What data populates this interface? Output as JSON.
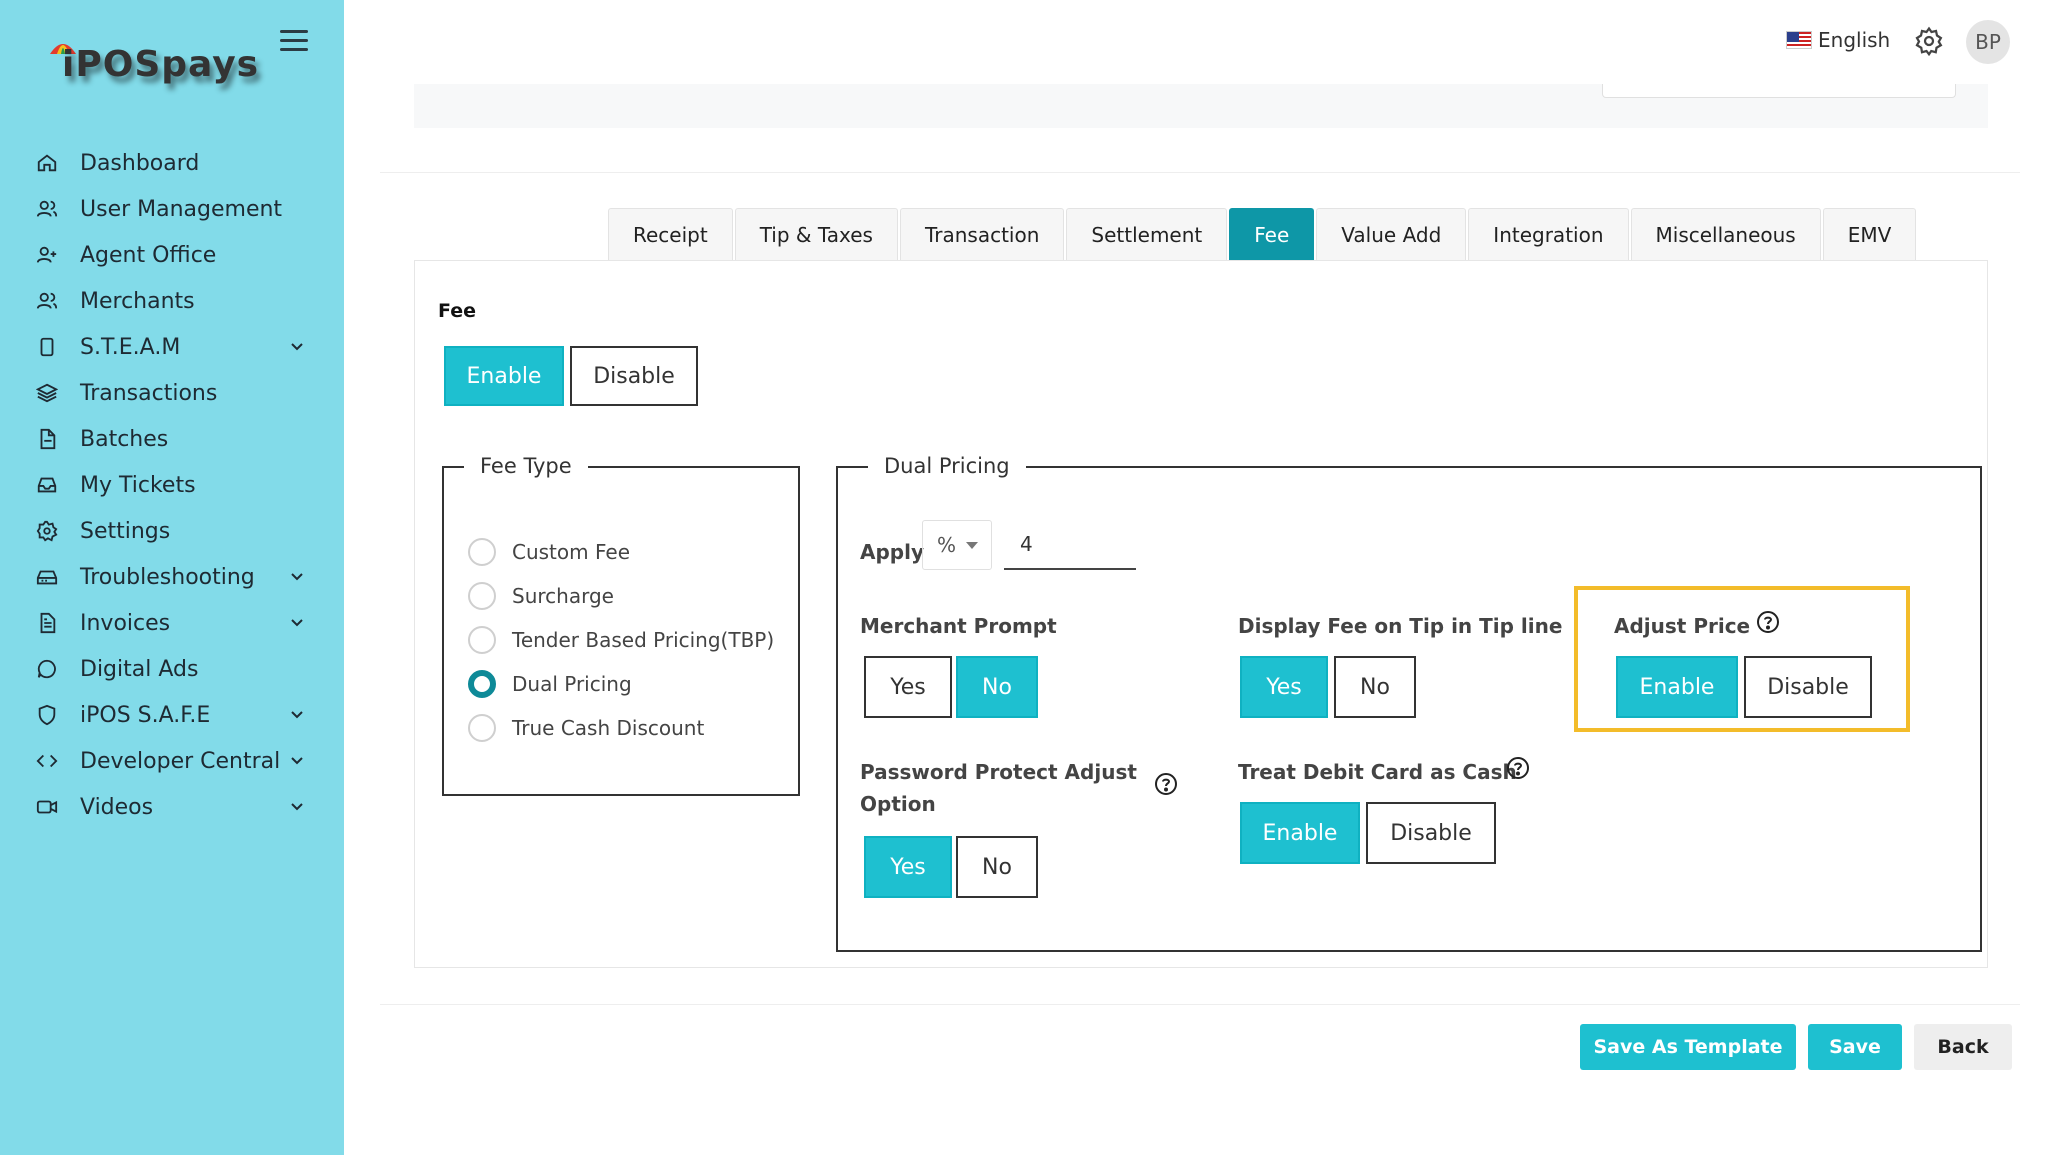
{
  "brand": {
    "logo_text": "iPOSpays"
  },
  "sidebar": {
    "items": [
      {
        "label": "Dashboard",
        "icon": "home-icon",
        "has_submenu": false
      },
      {
        "label": "User Management",
        "icon": "users-icon",
        "has_submenu": false
      },
      {
        "label": "Agent Office",
        "icon": "user-plus-icon",
        "has_submenu": false
      },
      {
        "label": "Merchants",
        "icon": "users-icon",
        "has_submenu": false
      },
      {
        "label": "S.T.E.A.M",
        "icon": "device-icon",
        "has_submenu": true
      },
      {
        "label": "Transactions",
        "icon": "layers-icon",
        "has_submenu": false
      },
      {
        "label": "Batches",
        "icon": "file-icon",
        "has_submenu": false
      },
      {
        "label": "My Tickets",
        "icon": "inbox-icon",
        "has_submenu": false
      },
      {
        "label": "Settings",
        "icon": "gear-icon",
        "has_submenu": false
      },
      {
        "label": "Troubleshooting",
        "icon": "drive-icon",
        "has_submenu": true
      },
      {
        "label": "Invoices",
        "icon": "invoice-icon",
        "has_submenu": true
      },
      {
        "label": "Digital Ads",
        "icon": "chat-icon",
        "has_submenu": false
      },
      {
        "label": "iPOS S.A.F.E",
        "icon": "shield-icon",
        "has_submenu": true
      },
      {
        "label": "Developer Central",
        "icon": "code-icon",
        "has_submenu": true
      },
      {
        "label": "Videos",
        "icon": "video-icon",
        "has_submenu": true
      }
    ]
  },
  "header": {
    "language": "English",
    "avatar_initials": "BP"
  },
  "tabs": [
    {
      "label": "Receipt",
      "active": false
    },
    {
      "label": "Tip & Taxes",
      "active": false
    },
    {
      "label": "Transaction",
      "active": false
    },
    {
      "label": "Settlement",
      "active": false
    },
    {
      "label": "Fee",
      "active": true
    },
    {
      "label": "Value Add",
      "active": false
    },
    {
      "label": "Integration",
      "active": false
    },
    {
      "label": "Miscellaneous",
      "active": false
    },
    {
      "label": "EMV",
      "active": false
    }
  ],
  "fee": {
    "title": "Fee",
    "enable_label": "Enable",
    "disable_label": "Disable",
    "selected": "Enable"
  },
  "fee_type": {
    "legend": "Fee Type",
    "options": [
      "Custom Fee",
      "Surcharge",
      "Tender Based Pricing(TBP)",
      "Dual Pricing",
      "True Cash Discount"
    ],
    "selected": "Dual Pricing"
  },
  "dual_pricing": {
    "legend": "Dual Pricing",
    "apply_label": "Apply",
    "apply_unit": "%",
    "apply_value": "4",
    "merchant_prompt": {
      "label": "Merchant Prompt",
      "yes": "Yes",
      "no": "No",
      "selected": "No"
    },
    "display_fee_tip": {
      "label": "Display Fee on Tip in Tip line",
      "yes": "Yes",
      "no": "No",
      "selected": "Yes"
    },
    "adjust_price": {
      "label": "Adjust Price",
      "enable": "Enable",
      "disable": "Disable",
      "selected": "Enable"
    },
    "password_protect": {
      "label_line1": "Password Protect Adjust",
      "label_line2": "Option",
      "yes": "Yes",
      "no": "No",
      "selected": "Yes"
    },
    "treat_debit": {
      "label": "Treat Debit Card as Cash",
      "enable": "Enable",
      "disable": "Disable",
      "selected": "Enable"
    }
  },
  "footer": {
    "save_template_label": "Save As Template",
    "save_label": "Save",
    "back_label": "Back"
  },
  "colors": {
    "sidebar_bg": "#82dbe9",
    "accent": "#1ec0d0",
    "tab_active": "#0e97a7",
    "highlight": "#f3bc2a"
  }
}
